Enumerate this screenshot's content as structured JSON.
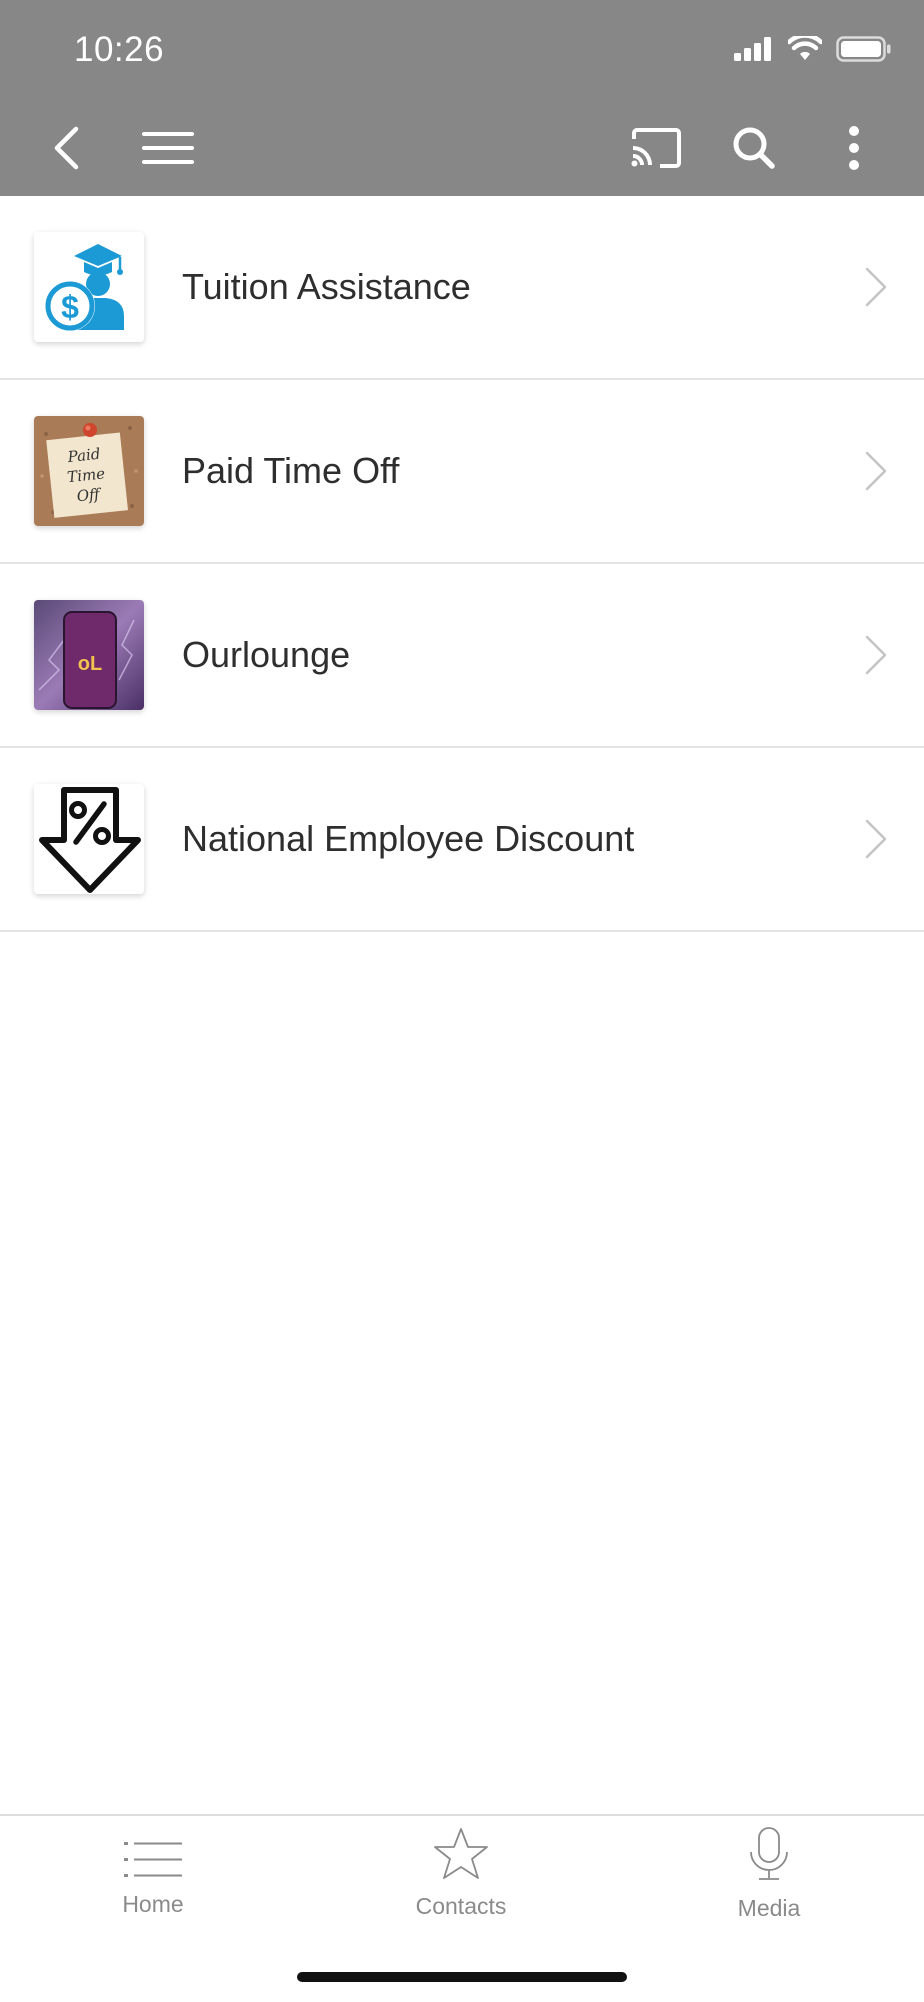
{
  "status_bar": {
    "time": "10:26"
  },
  "toolbar": {
    "icons": [
      "back-icon",
      "menu-icon",
      "cast-icon",
      "search-icon",
      "more-vertical-icon"
    ]
  },
  "list": {
    "items": [
      {
        "label": "Tuition Assistance",
        "icon": "graduate-dollar-icon"
      },
      {
        "label": "Paid Time Off",
        "icon": "sticky-note-image",
        "note_text": [
          "Paid",
          "Time",
          "Off"
        ]
      },
      {
        "label": "Ourlounge",
        "icon": "ourlounge-app-image",
        "logo_text": "oL"
      },
      {
        "label": "National Employee Discount",
        "icon": "percent-arrow-icon"
      }
    ]
  },
  "tabbar": {
    "tabs": [
      {
        "label": "Home",
        "icon": "list-icon"
      },
      {
        "label": "Contacts",
        "icon": "star-icon"
      },
      {
        "label": "Media",
        "icon": "microphone-icon"
      }
    ]
  },
  "colors": {
    "topbar": "#878787",
    "accent_blue": "#1c9ad6",
    "tab_inactive": "#8a8a8a"
  }
}
